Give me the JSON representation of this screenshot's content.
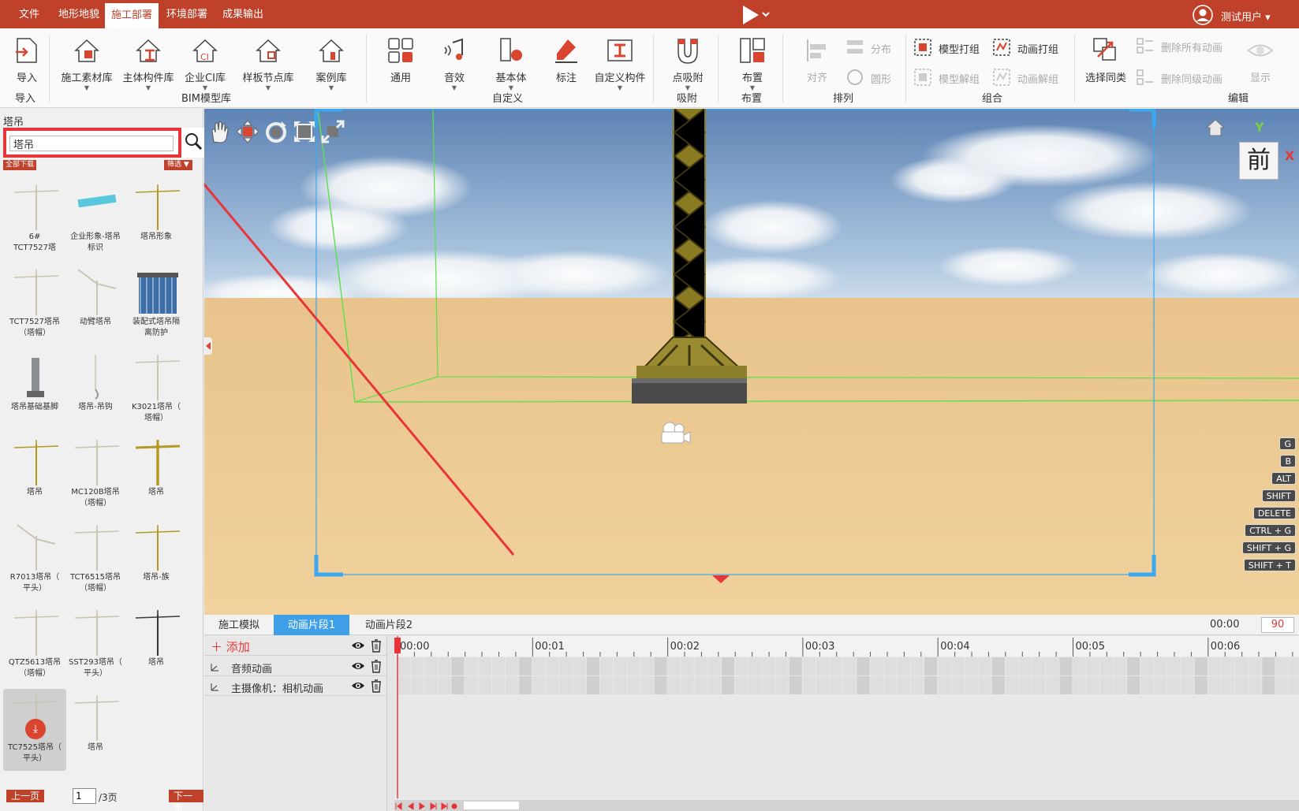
{
  "menubar": {
    "items": [
      "文件",
      "地形地貌",
      "施工部署",
      "环境部署",
      "成果输出"
    ],
    "active_index": 2,
    "user_name": "测试用户 ▾"
  },
  "ribbon": {
    "import": {
      "label": "导入",
      "group": "导入"
    },
    "bim": {
      "items": [
        "施工素材库",
        "主体构件库",
        "企业CI库",
        "样板节点库",
        "案例库"
      ],
      "group": "BIM模型库"
    },
    "custom": {
      "items": [
        "通用",
        "音效",
        "基本体",
        "标注",
        "自定义构件"
      ],
      "group": "自定义"
    },
    "snap": {
      "label": "点吸附",
      "group": "吸附"
    },
    "layout": {
      "label": "布置",
      "group": "布置"
    },
    "arrange": {
      "align": "对齐",
      "distribute": "分布",
      "shape": "圆形",
      "group": "排列"
    },
    "combine": {
      "model_group": "模型打组",
      "anim_group": "动画打组",
      "model_ungroup": "模型解组",
      "anim_ungroup": "动画解组",
      "group": "组合"
    },
    "edit": {
      "select_same": "选择同类",
      "delete_all_anim": "删除所有动画",
      "delete_same_anim": "删除同级动画",
      "show": "显示",
      "group": "编辑"
    }
  },
  "leftpanel": {
    "title": "塔吊",
    "search_value": "塔吊",
    "download_all": "全部下载",
    "filter": "筛选 ▼",
    "tiles": [
      {
        "name": "6#\nTCT7527塔",
        "kind": "crane"
      },
      {
        "name": "企业形象-塔吊\n标识",
        "kind": "sign"
      },
      {
        "name": "塔吊形象",
        "kind": "crane_yellow"
      },
      {
        "name": "TCT7527塔吊\n（塔帽）",
        "kind": "crane"
      },
      {
        "name": "动臂塔吊",
        "kind": "luffing"
      },
      {
        "name": "装配式塔吊隔\n离防护",
        "kind": "cage"
      },
      {
        "name": "塔吊基础基脚",
        "kind": "base"
      },
      {
        "name": "塔吊-吊钩",
        "kind": "hook"
      },
      {
        "name": "K3021塔吊（\n塔帽）",
        "kind": "crane_thin"
      },
      {
        "name": "塔吊",
        "kind": "crane_yellow"
      },
      {
        "name": "MC120B塔吊\n（塔帽）",
        "kind": "crane_thin"
      },
      {
        "name": "塔吊",
        "kind": "crane_yellow_big"
      },
      {
        "name": "R7013塔吊（\n平头）",
        "kind": "luffing"
      },
      {
        "name": "TCT6515塔吊\n（塔帽）",
        "kind": "crane_thin"
      },
      {
        "name": "塔吊-族",
        "kind": "crane_yellow"
      },
      {
        "name": "QTZ5613塔吊\n（塔帽）",
        "kind": "crane_thin"
      },
      {
        "name": "SST293塔吊（\n平头）",
        "kind": "crane_thin"
      },
      {
        "name": "塔吊",
        "kind": "crane_dark"
      },
      {
        "name": "TC7525塔吊（\n平头）",
        "kind": "crane_thin",
        "selected": true
      },
      {
        "name": "塔吊",
        "kind": "crane_thin"
      }
    ],
    "pager": {
      "prev": "上一页",
      "current": "1",
      "total": "/3页",
      "next": "下一页"
    }
  },
  "viewport": {
    "view_label": "前",
    "axis_y": "Y",
    "axis_x": "X",
    "shortcuts": [
      "G",
      "B",
      "ALT",
      "SHIFT",
      "DELETE",
      "CTRL + G",
      "SHIFT + G",
      "SHIFT + T"
    ],
    "tools": [
      "hand-icon",
      "move-icon",
      "rotate-icon",
      "scale-icon",
      "fullscreen-icon"
    ]
  },
  "timeline": {
    "tabs": [
      "施工模拟",
      "动画片段1",
      "动画片段2"
    ],
    "active_tab": 1,
    "time": "00:00",
    "frames": "90",
    "add_label": "＋ 添加",
    "tracks": [
      "音频动画",
      "主摄像机：相机动画"
    ],
    "ticks": [
      "00:00",
      "00:01",
      "00:02",
      "00:03",
      "00:04",
      "00:05",
      "00:06"
    ]
  },
  "colors": {
    "brand": "#c0412a",
    "highlight": "#e8353a",
    "tab_active": "#3fa0e8"
  }
}
